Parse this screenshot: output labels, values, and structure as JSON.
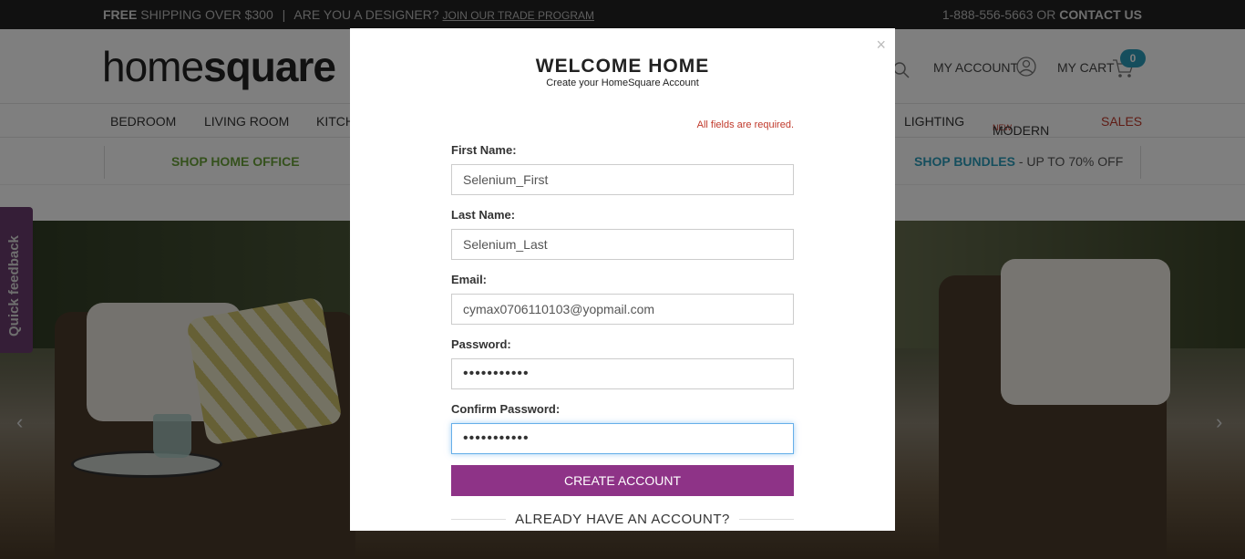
{
  "topbar": {
    "free": "FREE",
    "shipping": "SHIPPING OVER $300",
    "separator": "|",
    "designer_q": "ARE YOU A DESIGNER?",
    "trade_link": "JOIN OUR TRADE PROGRAM",
    "phone": "1-888-556-5663",
    "or": "OR",
    "contact": "CONTACT US"
  },
  "header": {
    "logo_light": "home",
    "logo_bold": "square",
    "my_account": "MY ACCOUNT",
    "my_cart": "MY CART",
    "cart_count": "0"
  },
  "nav": {
    "items": [
      "BEDROOM",
      "LIVING ROOM",
      "KITCH",
      "LIGHTING",
      "MODERN",
      "SALES"
    ],
    "new_tag": "NEW"
  },
  "promo": {
    "left": "SHOP HOME OFFICE",
    "right": "SHOP BUNDLES",
    "right_suffix": " - UP TO 70% OFF"
  },
  "feedback_tab": "Quick feedback",
  "modal": {
    "close": "×",
    "title": "WELCOME HOME",
    "subtitle": "Create your HomeSquare Account",
    "required_note": "All fields are required.",
    "fields": [
      {
        "label": "First Name:",
        "value": "Selenium_First"
      },
      {
        "label": "Last Name:",
        "value": "Selenium_Last"
      },
      {
        "label": "Email:",
        "value": "cymax0706110103@yopmail.com"
      },
      {
        "label": "Password:",
        "value": "•••••••••••"
      },
      {
        "label": "Confirm Password:",
        "value": "•••••••••••"
      }
    ],
    "create_button": "CREATE ACCOUNT",
    "already": "ALREADY HAVE AN ACCOUNT?"
  },
  "colors": {
    "accent_purple": "#8e3387",
    "cart_badge": "#2a9dba",
    "promo_green": "#6aa33a",
    "promo_blue": "#2a9dba",
    "sales_red": "#c0392b"
  }
}
